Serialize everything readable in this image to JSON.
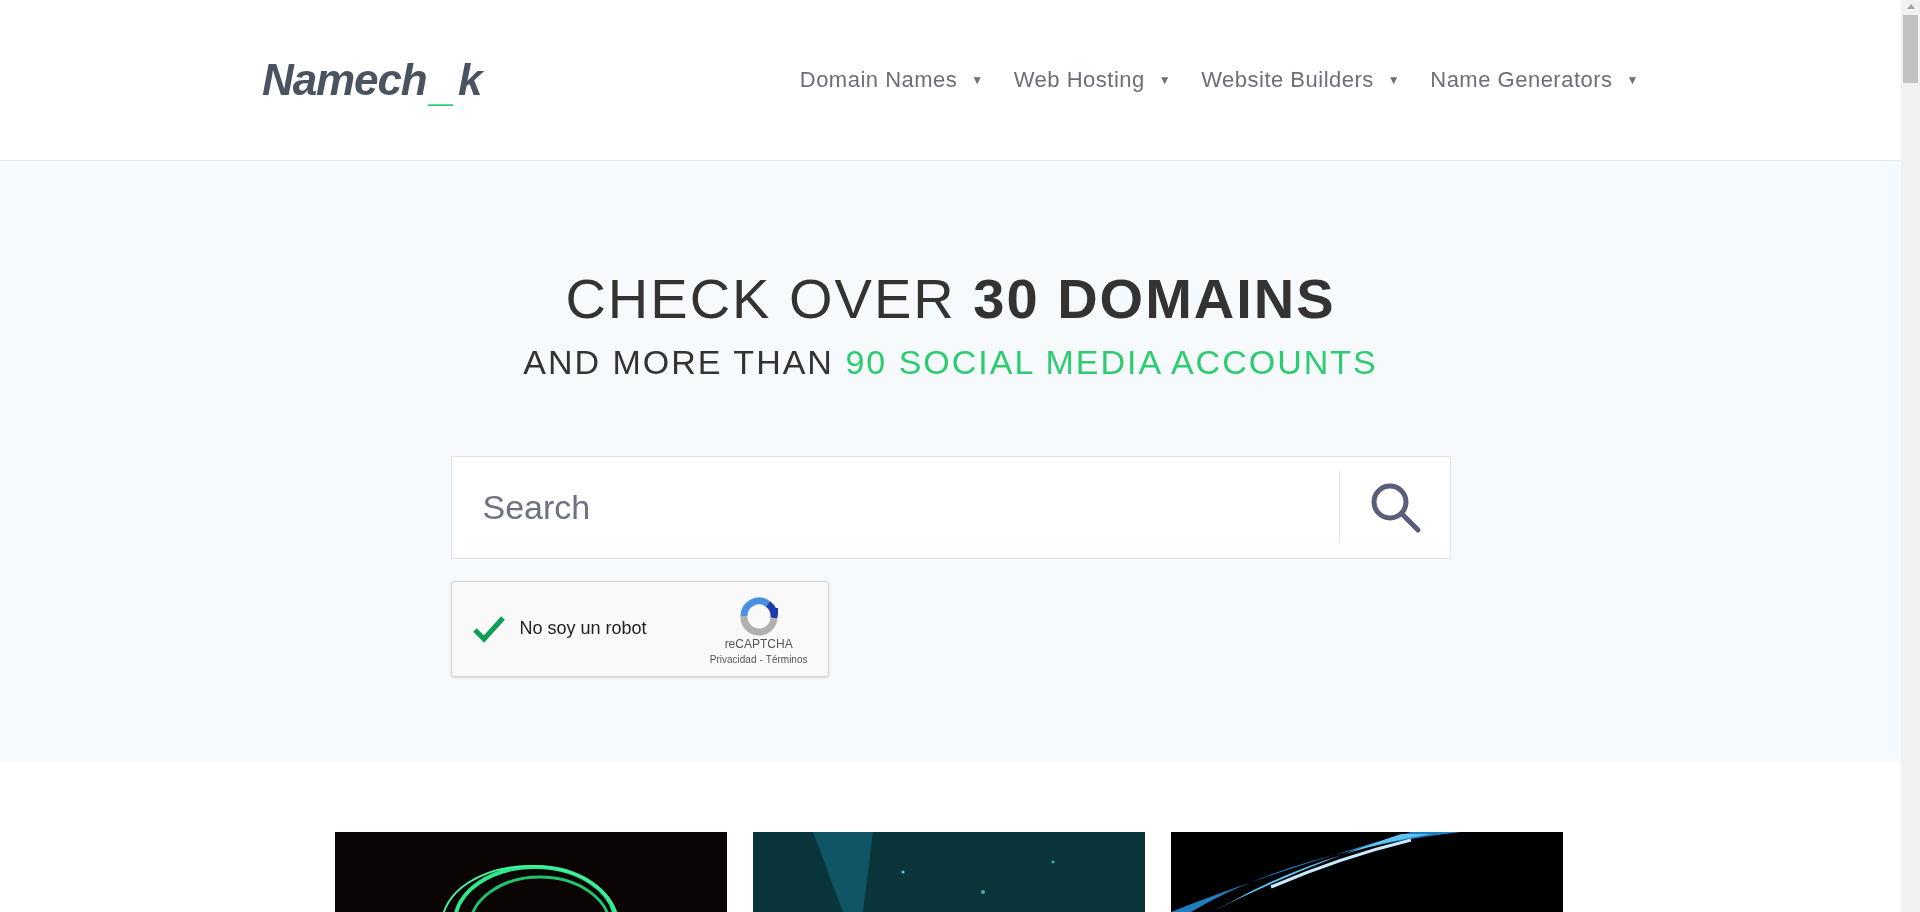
{
  "logo": {
    "parts": [
      {
        "text": "Namech",
        "accent": false
      },
      {
        "text": "_",
        "accent": true
      },
      {
        "text": "k",
        "accent": false
      }
    ]
  },
  "nav": [
    {
      "label": "Domain Names",
      "caret": "▼"
    },
    {
      "label": "Web Hosting",
      "caret": "▼"
    },
    {
      "label": "Website Builders",
      "caret": "▼"
    },
    {
      "label": "Name Generators",
      "caret": "▼"
    }
  ],
  "hero": {
    "heading": "CHECK OVER **30 DOMAINS**",
    "subheading": {
      "lead": "AND MORE THAN ",
      "accent": "90 SOCIAL MEDIA ACCOUNTS"
    }
  },
  "search": {
    "placeholder": "Search"
  },
  "captcha": {
    "label": "No soy un robot",
    "checked": true,
    "brand": "reCAPTCHA",
    "links": [
      "Privacidad",
      "Términos"
    ],
    "separator": "-"
  }
}
